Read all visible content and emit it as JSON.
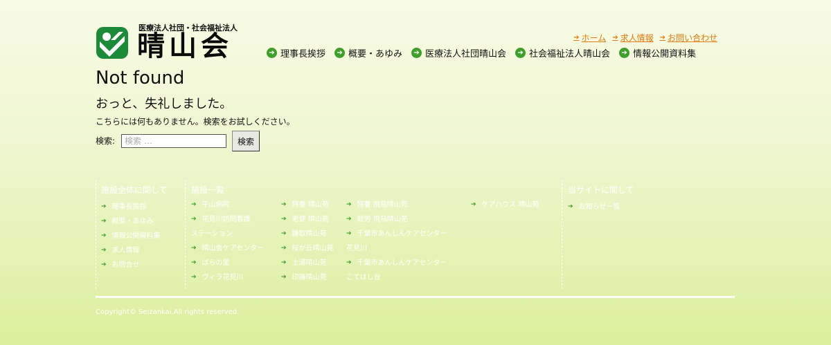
{
  "logo": {
    "subtitle": "医療法人社団・社会福祉法人",
    "name": "晴山会"
  },
  "top_links": [
    {
      "label": "ホーム"
    },
    {
      "label": "求人情報"
    },
    {
      "label": "お問い合わせ"
    }
  ],
  "main_nav": [
    {
      "label": "理事長挨拶"
    },
    {
      "label": "概要・あゆみ"
    },
    {
      "label": "医療法人社団晴山会"
    },
    {
      "label": "社会福祉法人晴山会"
    },
    {
      "label": "情報公開資料集"
    }
  ],
  "content": {
    "title": "Not found",
    "heading": "おっと、失礼しました。",
    "message": "こちらには何もありません。検索をお試しください。",
    "search_label": "検索:",
    "search_placeholder": "検索 …",
    "search_value": "",
    "search_button": "検索"
  },
  "footer": {
    "col1": {
      "heading": "施設全体に関して",
      "links": [
        "理事長挨拶",
        "概要・あゆみ",
        "情報公開資料集",
        "求人情報",
        "お問合せ"
      ]
    },
    "col2": {
      "heading": "施設一覧",
      "a": [
        "平山病院",
        "花見川訪問看護",
        "ステーション",
        "晴山会ケアセンター",
        "ばらの里",
        "ヴィラ花見川"
      ],
      "b": [
        "特養 晴山苑",
        "老健 晴山苑",
        "鎌取晴山苑",
        "桜が丘晴山苑",
        "土浦晴山苑",
        "印旛晴山苑"
      ],
      "c": [
        "特養 飛鳥晴山苑",
        "就労 飛鳥晴山苑",
        "千葉市あんしんケアセンター",
        "花見川",
        "千葉市あんしんケアセンター",
        "こてはし台"
      ],
      "d": [
        "ケアハウス 晴山苑"
      ]
    },
    "col3": {
      "heading": "当サイトに関して",
      "links": [
        "お知らせ一覧"
      ]
    },
    "copyright": "Copyright© Seizankai.All rights reserved."
  },
  "colors": {
    "accent_green": "#3f9e2c",
    "link_orange": "#e07a10"
  }
}
